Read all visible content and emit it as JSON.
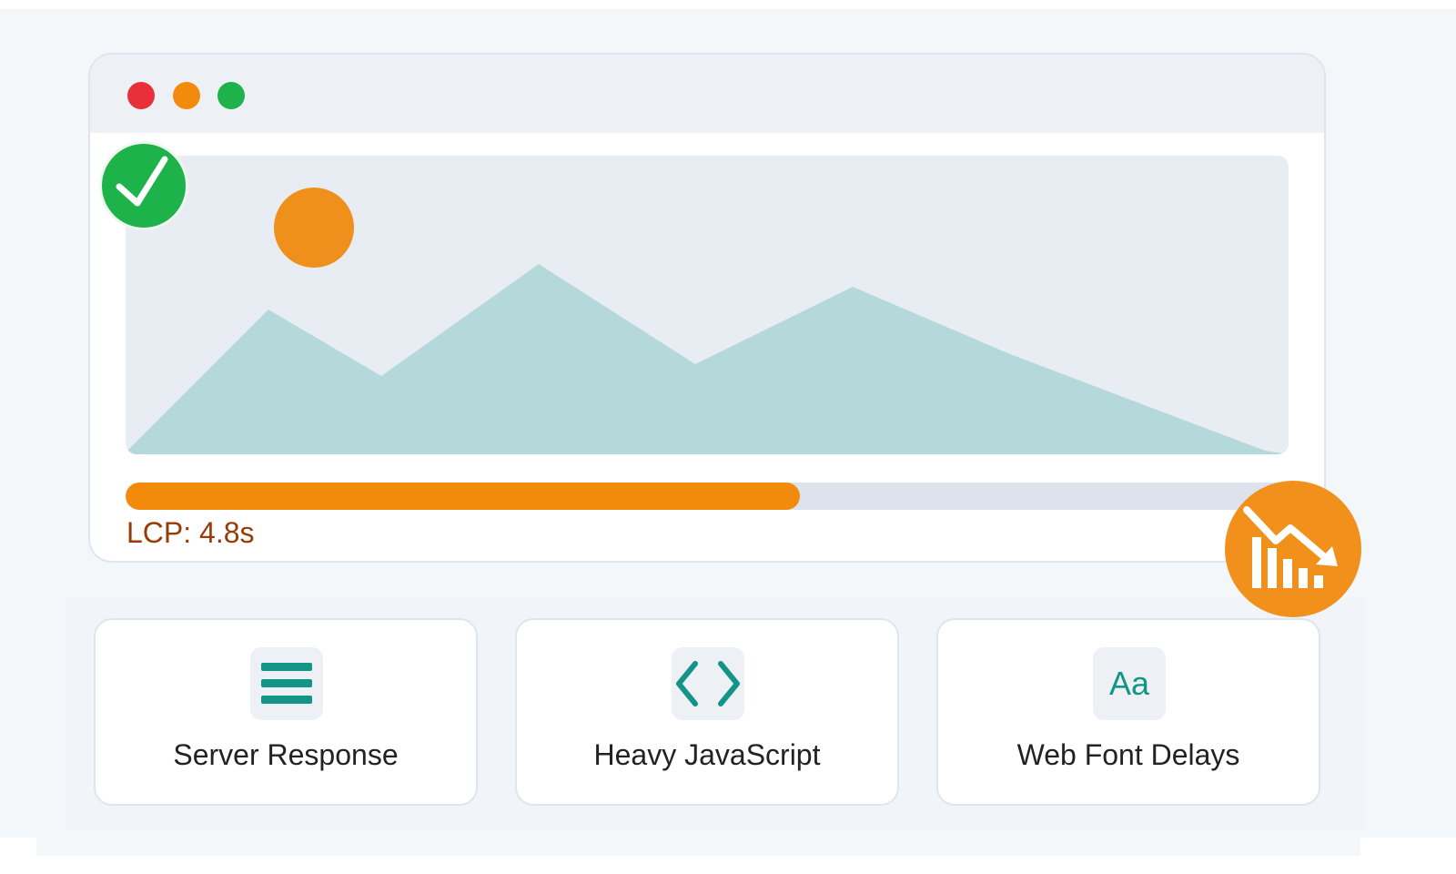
{
  "browser": {
    "window_controls": [
      {
        "name": "close",
        "color": "#e8303a"
      },
      {
        "name": "minimize",
        "color": "#f28a0c"
      },
      {
        "name": "maximize",
        "color": "#1db34a"
      }
    ],
    "hero_image": {
      "sun_color": "#f0901c",
      "mountain_color": "#b5d9db",
      "background_color": "#e8edf4"
    },
    "progress": {
      "value": 0.58,
      "fill_color": "#f28a0c",
      "track_color": "#dde3ec"
    },
    "lcp_label": "LCP: 4.8s"
  },
  "badges": {
    "success": {
      "icon": "checkmark-icon",
      "color": "#1db34a"
    },
    "performance": {
      "icon": "declining-chart-icon",
      "color": "#f2901c"
    }
  },
  "cards": [
    {
      "icon": "server-lines-icon",
      "label": "Server Response"
    },
    {
      "icon": "code-brackets-icon",
      "label": "Heavy JavaScript"
    },
    {
      "icon": "font-icon",
      "icon_text": "Aa",
      "label": "Web Font Delays"
    }
  ],
  "accent_color": "#129587"
}
